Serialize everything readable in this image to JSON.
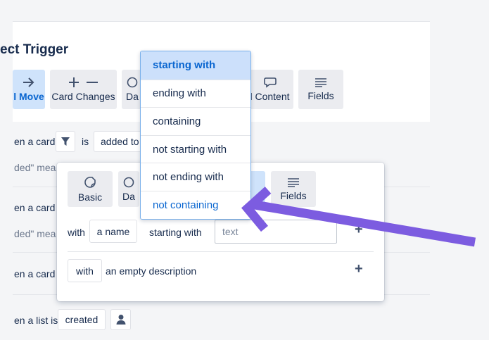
{
  "panel": {
    "title": "ect Trigger"
  },
  "trigger_tabs": [
    {
      "label": "l Move",
      "icon": "arrow-right-icon"
    },
    {
      "label": "Card Changes",
      "icon": "plus-minus-icon"
    },
    {
      "label": "Da",
      "icon": "clock-icon"
    },
    {
      "label": "l Content",
      "icon": "speech-bubble-icon"
    },
    {
      "label": "Fields",
      "icon": "lines-icon"
    }
  ],
  "rules": [
    {
      "prefix": "en a card",
      "verb": "is",
      "value": "added to",
      "note": "ded\" mea"
    },
    {
      "prefix": "en a card",
      "note": "ded\" mea"
    },
    {
      "prefix": "en a card"
    },
    {
      "prefix": "en a list is",
      "value": "created"
    }
  ],
  "popup": {
    "tabs": [
      {
        "label": "Basic",
        "icon": "tag-icon"
      },
      {
        "label": "Da",
        "icon": "clock-icon"
      },
      {
        "label": "Fields",
        "icon": "lines-icon"
      }
    ],
    "with_label": "with",
    "name_chip": "a name",
    "operator": "starting with",
    "text_placeholder": "text",
    "with_chip": "with",
    "description_text": "an empty description"
  },
  "dropdown": {
    "options": [
      "starting with",
      "ending with",
      "containing",
      "not starting with",
      "not ending with",
      "not containing"
    ],
    "selected": "starting with"
  },
  "colors": {
    "accent": "#0a66d0",
    "selected_bg": "#cce0fb",
    "arrow": "#7c5ce0"
  }
}
